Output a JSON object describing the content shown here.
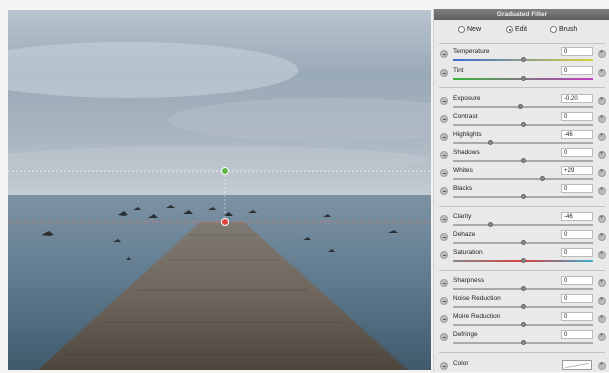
{
  "panel": {
    "title": "Graduated Filter",
    "modes": [
      {
        "label": "New",
        "selected": false
      },
      {
        "label": "Edit",
        "selected": true
      },
      {
        "label": "Brush",
        "selected": false
      }
    ],
    "sliders": [
      {
        "label": "Temperature",
        "value": "0",
        "level": 0.5
      },
      {
        "label": "Tint",
        "value": "0",
        "level": 0.5
      },
      {
        "label": "Exposure",
        "value": "-0.20",
        "level": 0.48
      },
      {
        "label": "Contrast",
        "value": "0",
        "level": 0.5
      },
      {
        "label": "Highlights",
        "value": "-46",
        "level": 0.27
      },
      {
        "label": "Shadows",
        "value": "0",
        "level": 0.5
      },
      {
        "label": "Whites",
        "value": "+29",
        "level": 0.64
      },
      {
        "label": "Blacks",
        "value": "0",
        "level": 0.5
      },
      {
        "label": "Clarity",
        "value": "-46",
        "level": 0.27
      },
      {
        "label": "Dehaze",
        "value": "0",
        "level": 0.5
      },
      {
        "label": "Saturation",
        "value": "0",
        "level": 0.5
      },
      {
        "label": "Sharpness",
        "value": "0",
        "level": 0.5
      },
      {
        "label": "Noise Reduction",
        "value": "0",
        "level": 0.5
      },
      {
        "label": "Moire Reduction",
        "value": "0",
        "level": 0.5
      },
      {
        "label": "Defringe",
        "value": "0",
        "level": 0.5
      }
    ],
    "color_label": "Color"
  },
  "filter_overlay": {
    "top_pin_color": "#5fb548",
    "bottom_pin_color": "#e0443a"
  }
}
